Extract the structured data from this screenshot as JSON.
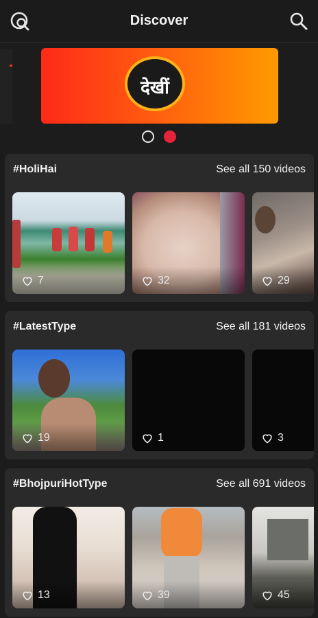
{
  "header": {
    "title": "Discover",
    "left_icon": "discover-search-icon",
    "right_icon": "search-icon"
  },
  "banner": {
    "logo_text": "देखीं",
    "pager": {
      "count": 2,
      "active_index": 1
    }
  },
  "sections": [
    {
      "tag": "#HoliHai",
      "see_all": "See all 150 videos",
      "videos": [
        {
          "likes": "7"
        },
        {
          "likes": "32"
        },
        {
          "likes": "29"
        }
      ]
    },
    {
      "tag": "#LatestType",
      "see_all": "See all 181 videos",
      "videos": [
        {
          "likes": "19"
        },
        {
          "likes": "1"
        },
        {
          "likes": "3"
        }
      ]
    },
    {
      "tag": "#BhojpuriHotType",
      "see_all": "See all 691 videos",
      "videos": [
        {
          "likes": "13"
        },
        {
          "likes": "39"
        },
        {
          "likes": "45"
        }
      ]
    }
  ],
  "colors": {
    "background": "#1c1c1c",
    "card": "#2a2a2a",
    "accent": "#e3243b",
    "banner_start": "#ff2a18",
    "banner_end": "#ff9a00"
  }
}
